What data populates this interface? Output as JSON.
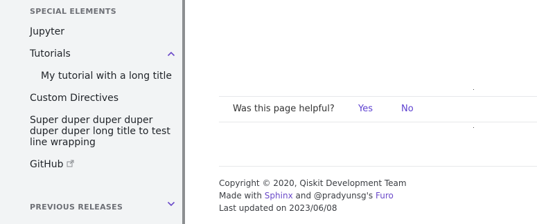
{
  "sidebar": {
    "special_elements_title": "SPECIAL ELEMENTS",
    "items": [
      {
        "label": "Jupyter"
      },
      {
        "label": "Tutorials"
      },
      {
        "label": "My tutorial with a long title"
      },
      {
        "label": "Custom Directives"
      },
      {
        "label": "Super duper duper duper duper duper long title to test line wrapping"
      },
      {
        "label": "GitHub"
      }
    ],
    "previous_releases_title": "PREVIOUS RELEASES"
  },
  "feedback": {
    "question": "Was this page helpful?",
    "yes_label": "Yes",
    "no_label": "No"
  },
  "footer": {
    "copyright": "Copyright © 2020, Qiskit Development Team",
    "made_with_prefix": "Made with ",
    "sphinx_link": "Sphinx",
    "and_text": " and @pradyunsg's ",
    "furo_link": "Furo",
    "last_updated": "Last updated on 2023/06/08"
  },
  "colors": {
    "accent": "#6a49c9",
    "sidebar_bg": "#f2f4f5",
    "sidebar_border": "#8c8f91"
  },
  "icons": {
    "tutorials_toggle": "chevron-up-icon",
    "previous_releases_toggle": "chevron-down-icon",
    "github_external": "external-link-icon"
  }
}
